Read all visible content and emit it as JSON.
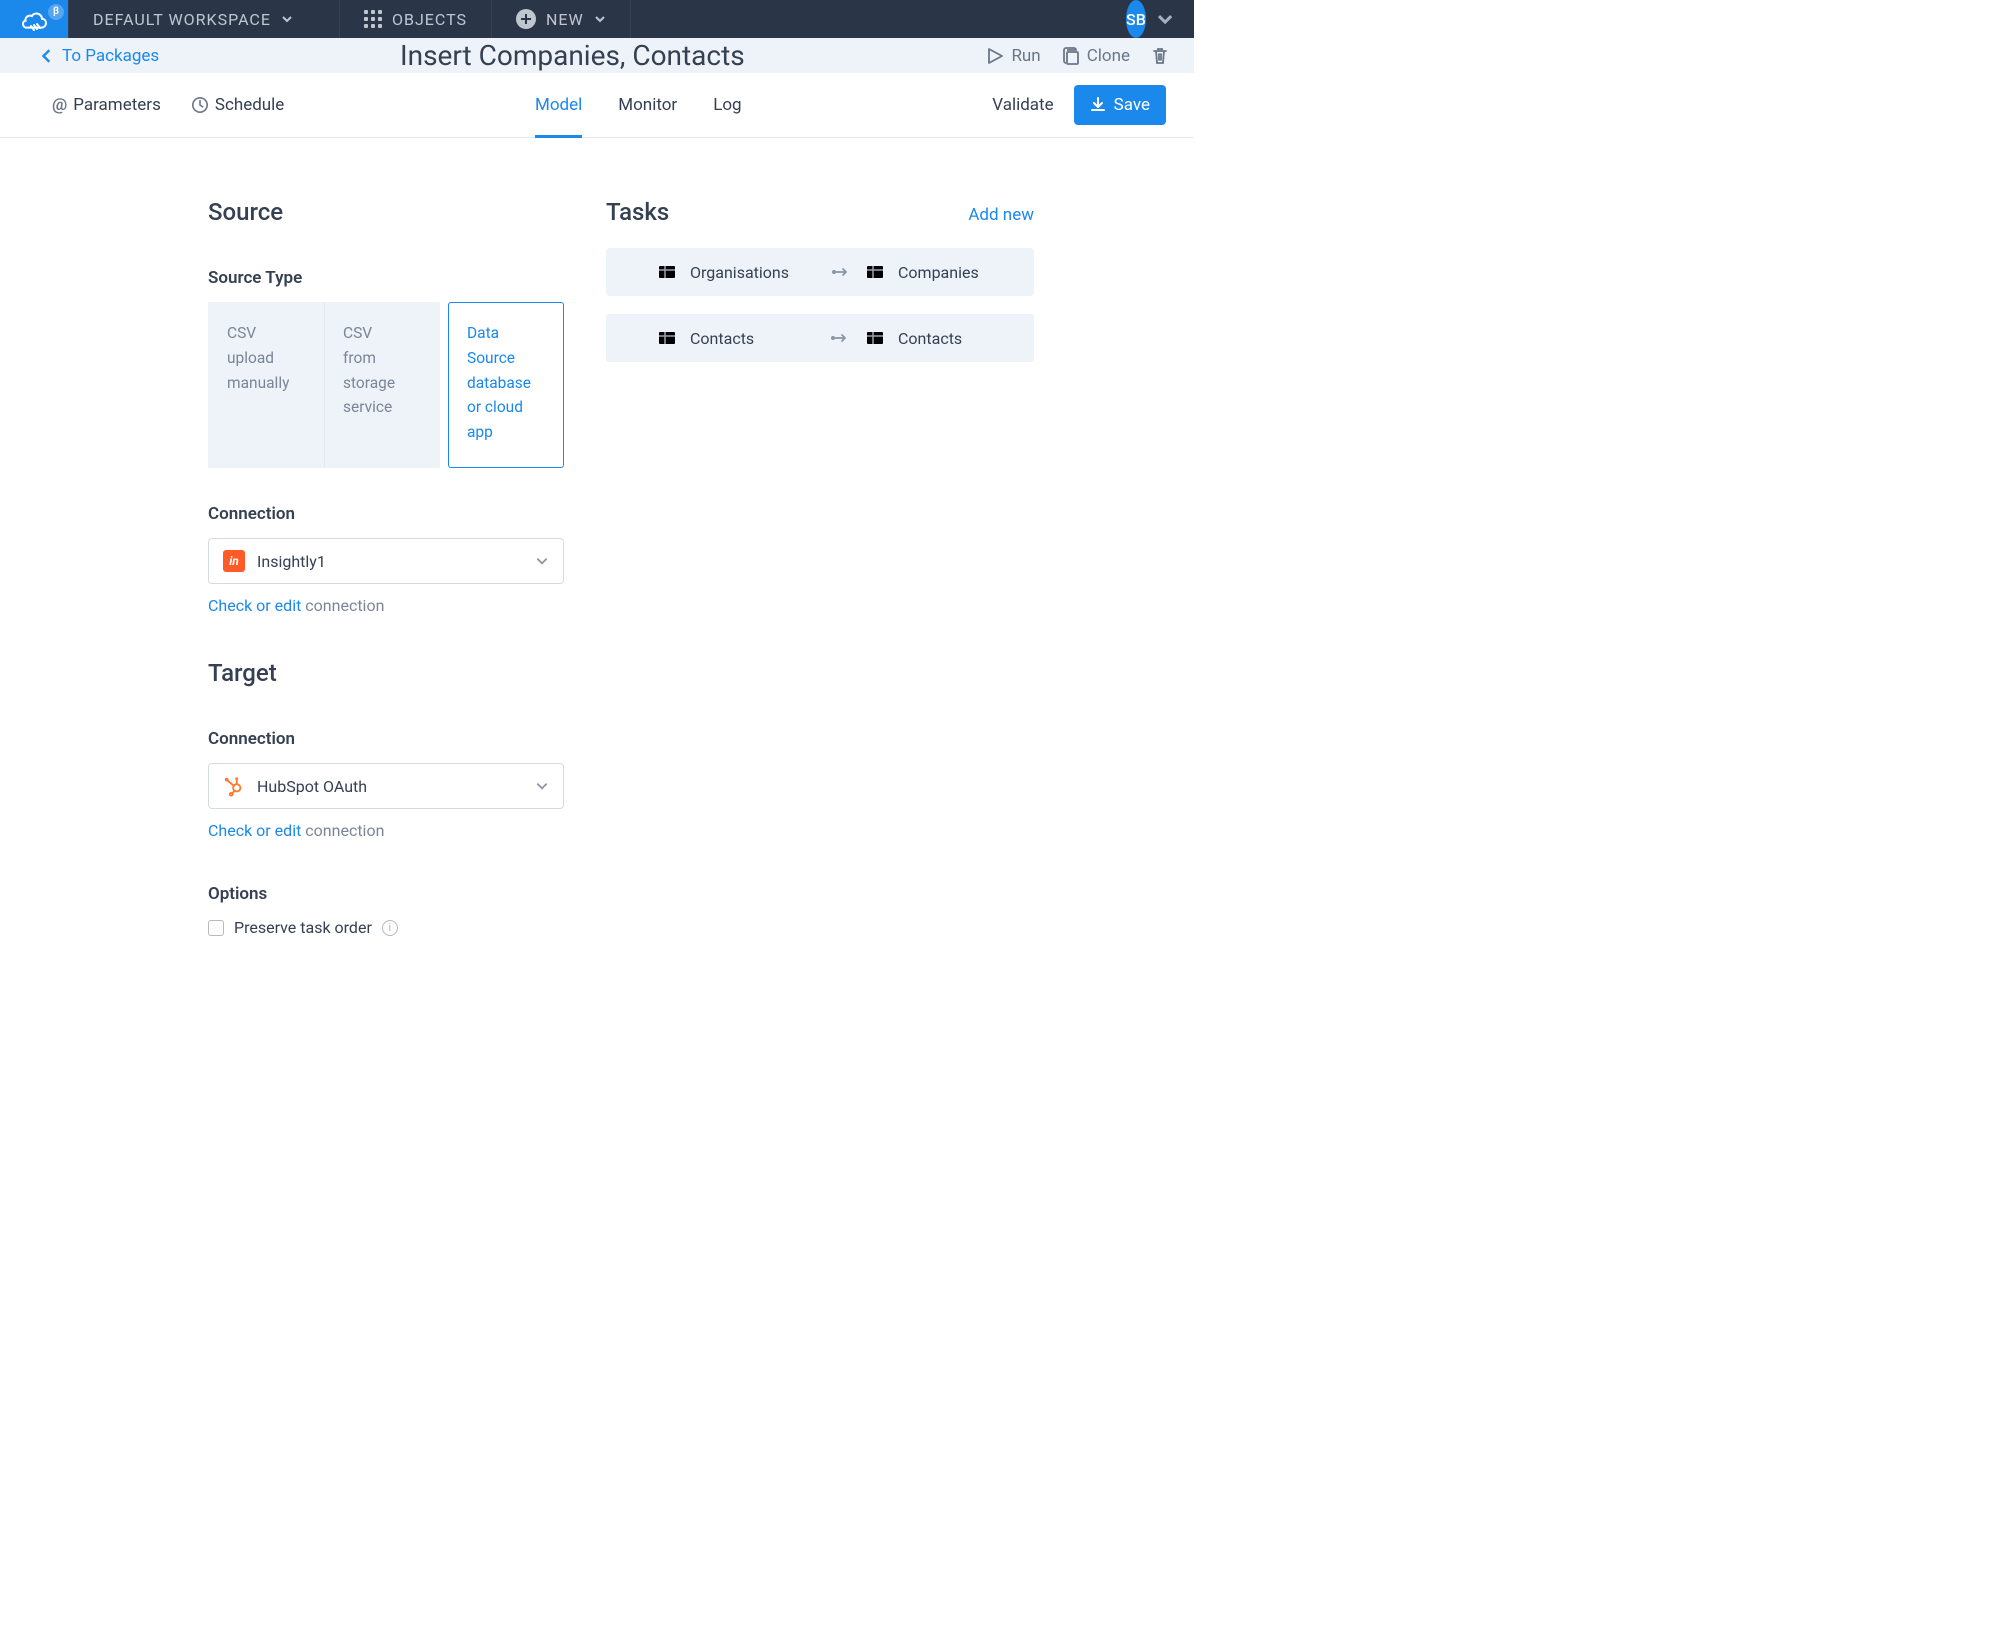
{
  "topnav": {
    "workspace": "DEFAULT WORKSPACE",
    "objects": "OBJECTS",
    "new": "NEW",
    "avatar": "SB",
    "beta": "β"
  },
  "header": {
    "back": "To Packages",
    "title": "Insert Companies, Contacts",
    "run": "Run",
    "clone": "Clone"
  },
  "subnav": {
    "parameters": "Parameters",
    "schedule": "Schedule",
    "tabs": {
      "model": "Model",
      "monitor": "Monitor",
      "log": "Log"
    },
    "validate": "Validate",
    "save": "Save"
  },
  "source": {
    "heading": "Source",
    "source_type_label": "Source Type",
    "types": [
      {
        "line1": "CSV",
        "line2": "upload manually"
      },
      {
        "line1": "CSV",
        "line2": "from storage service"
      },
      {
        "line1": "Data Source",
        "line2": "database or cloud app"
      }
    ],
    "connection_label": "Connection",
    "connection_value": "Insightly1",
    "check_edit": "Check or edit",
    "check_edit_tail": " connection"
  },
  "target": {
    "heading": "Target",
    "connection_label": "Connection",
    "connection_value": "HubSpot OAuth",
    "check_edit": "Check or edit",
    "check_edit_tail": " connection"
  },
  "options": {
    "heading": "Options",
    "preserve": "Preserve task order"
  },
  "tasks": {
    "heading": "Tasks",
    "add_new": "Add new",
    "rows": [
      {
        "from": "Organisations",
        "to": "Companies"
      },
      {
        "from": "Contacts",
        "to": "Contacts"
      }
    ]
  }
}
